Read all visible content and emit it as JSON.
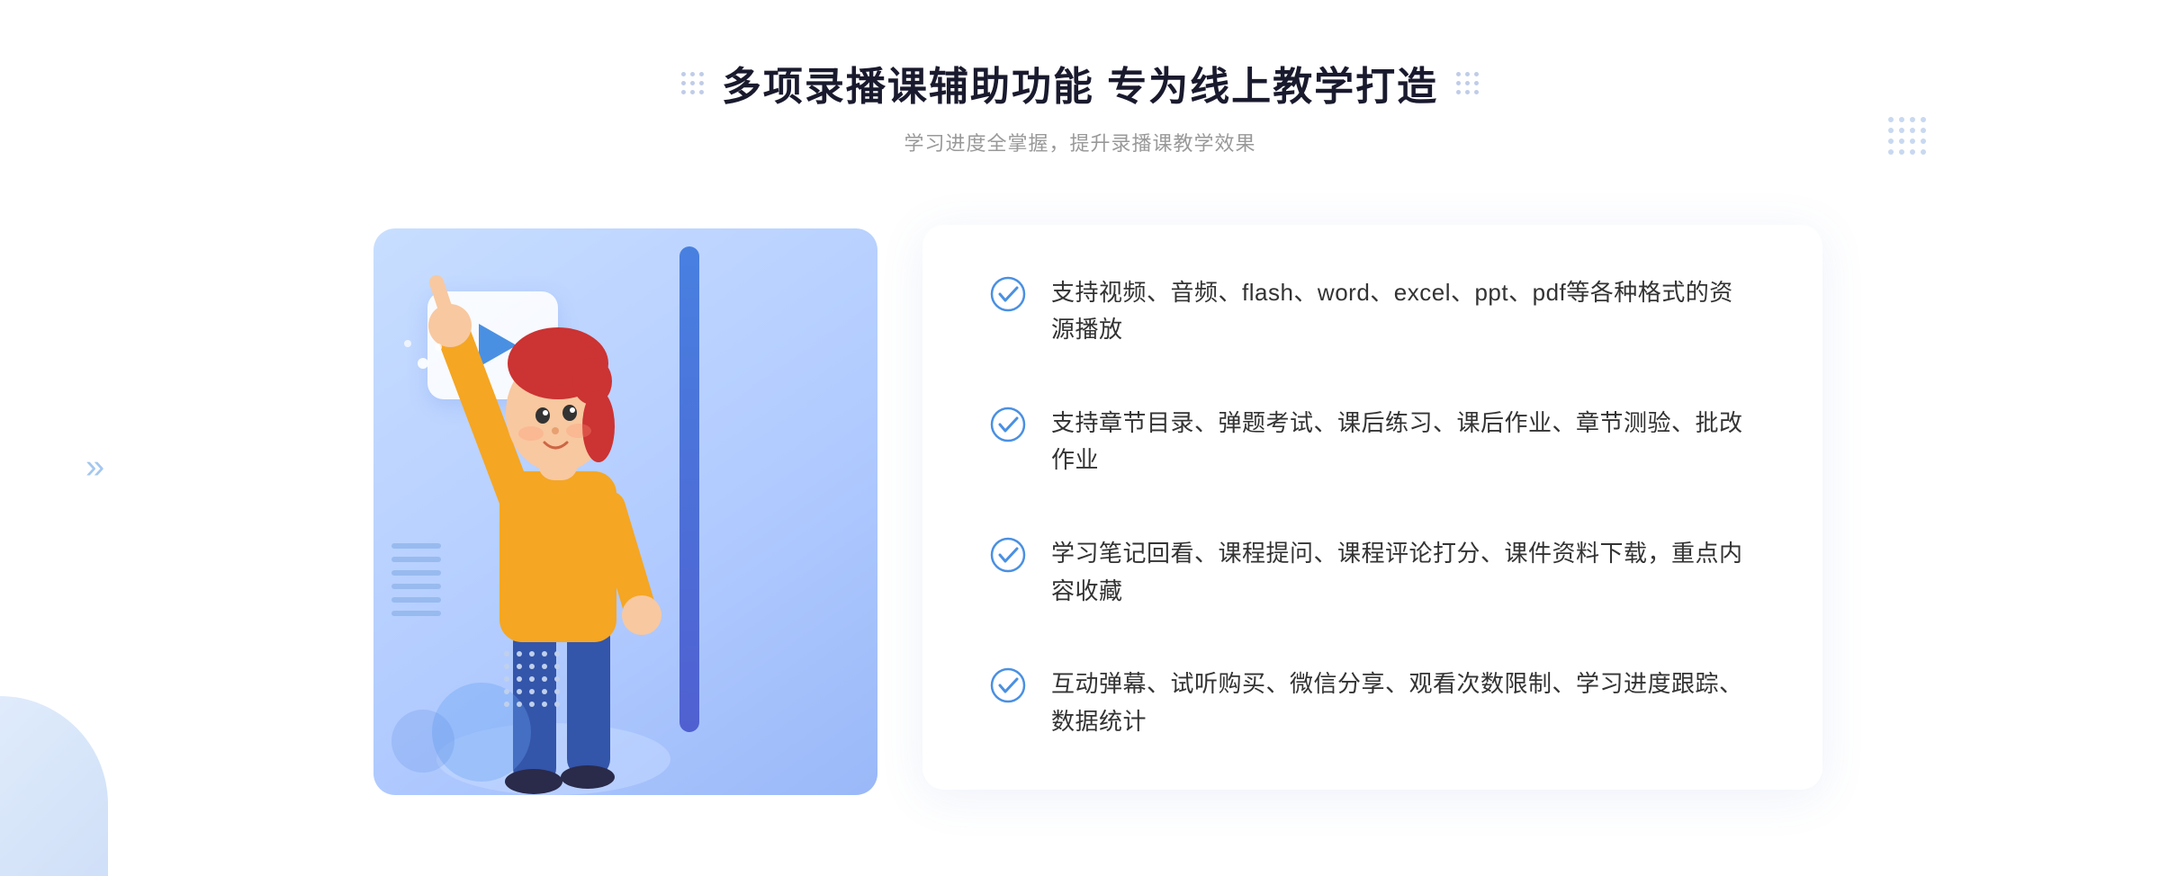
{
  "page": {
    "background_color": "#ffffff"
  },
  "header": {
    "title": "多项录播课辅助功能 专为线上教学打造",
    "subtitle": "学习进度全掌握，提升录播课教学效果"
  },
  "features": [
    {
      "id": 1,
      "text": "支持视频、音频、flash、word、excel、ppt、pdf等各种格式的资源播放"
    },
    {
      "id": 2,
      "text": "支持章节目录、弹题考试、课后练习、课后作业、章节测验、批改作业"
    },
    {
      "id": 3,
      "text": "学习笔记回看、课程提问、课程评论打分、课件资料下载，重点内容收藏"
    },
    {
      "id": 4,
      "text": "互动弹幕、试听购买、微信分享、观看次数限制、学习进度跟踪、数据统计"
    }
  ],
  "decorative": {
    "chevron_char": "»",
    "play_symbol": "▶"
  }
}
